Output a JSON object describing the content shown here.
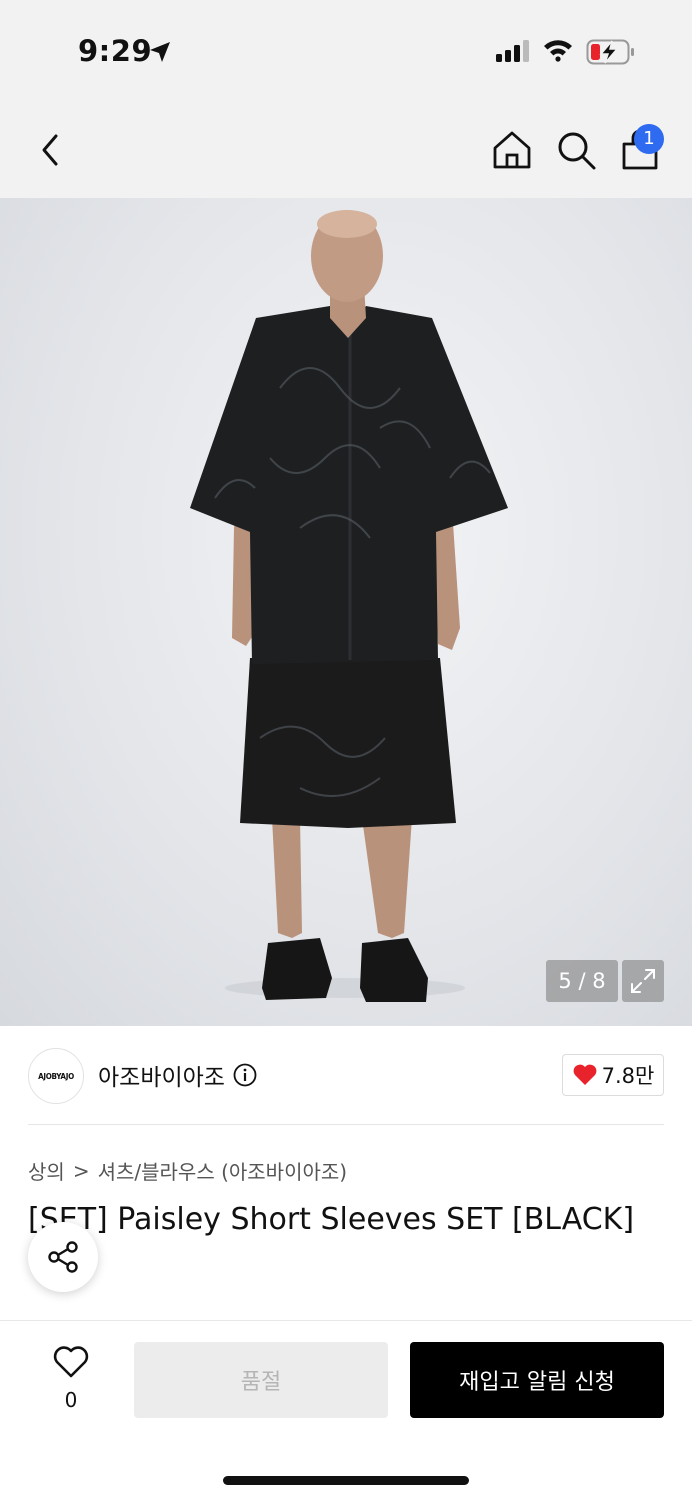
{
  "status_bar": {
    "time": "9:29"
  },
  "nav": {
    "cart_count": "1"
  },
  "gallery": {
    "counter": "5 / 8"
  },
  "brand": {
    "logo_text": "AJOBYAJO",
    "name": "아조바이아조",
    "likes": "7.8만"
  },
  "breadcrumb": {
    "category": "상의",
    "separator": ">",
    "subcategory": "셔츠/블라우스 (아조바이아조)"
  },
  "product": {
    "title": "[SET] Paisley Short Sleeves SET [BLACK]"
  },
  "bottom": {
    "wish_count": "0",
    "soldout_label": "품절",
    "restock_label": "재입고 알림 신청"
  },
  "colors": {
    "badge": "#2e6bf0",
    "heart": "#e8232b",
    "primary_button": "#000000",
    "disabled_button": "#ececec"
  }
}
